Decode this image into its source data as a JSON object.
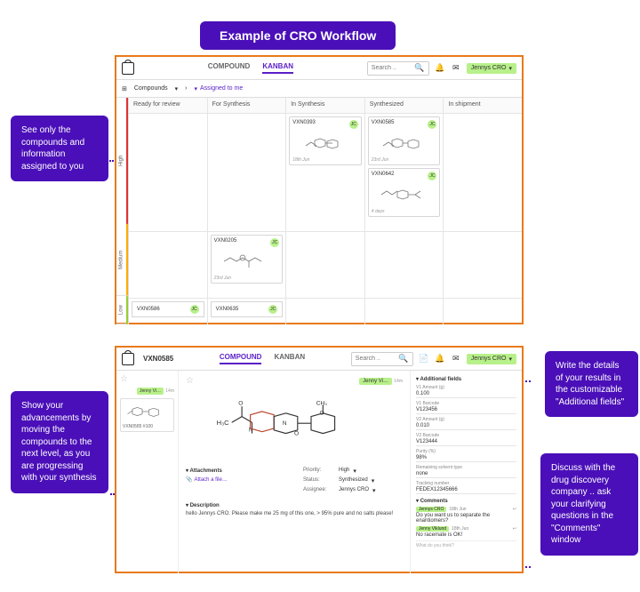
{
  "title": "Example of CRO Workflow",
  "callouts": {
    "c1": "See only the compounds and information assigned to you",
    "c2": "Write the details of your results in the customizable \"Additional fields\"",
    "c3": "Show your advancements by moving the compounds to the next level, as you are progressing with your synthesis",
    "c4": "Discuss with the drug discovery company .. ask your clarifying questions in the \"Comments\" window"
  },
  "header": {
    "tab_compound": "COMPOUND",
    "tab_kanban": "KANBAN",
    "search_placeholder": "Search ..",
    "user": "Jennys CRO"
  },
  "subheader": {
    "compounds": "Compounds",
    "filter": "Assigned to me"
  },
  "priority": {
    "high": "High",
    "medium": "Medium",
    "low": "Low"
  },
  "columns": [
    "Ready for review",
    "For Synthesis",
    "In Synthesis",
    "Synthesized",
    "In shipment"
  ],
  "cards": {
    "insynth": [
      {
        "id": "VXN0393",
        "date": "18th Jun",
        "av": "JC"
      }
    ],
    "synth": [
      {
        "id": "VXN0585",
        "date": "23rd Jun",
        "av": "JC"
      },
      {
        "id": "VXN0642",
        "date": "4 days",
        "av": "JC"
      }
    ],
    "forsynth": [
      {
        "id": "VXN0205",
        "date": "23rd Jun",
        "av": "JC"
      }
    ],
    "low_ready": {
      "id": "VXN0586",
      "av": "JC"
    },
    "low_forsynth": {
      "id": "VXN0635",
      "av": "JC"
    }
  },
  "detail": {
    "id": "VXN0585",
    "thumb_name": "VXN0585 #100",
    "assignee_chip": "Jenny Vi…",
    "time_meta": "14m",
    "attachments_h": "Attachments",
    "attach_link": "Attach a file…",
    "priority_l": "Priority:",
    "priority_v": "High",
    "status_l": "Status:",
    "status_v": "Synthesized",
    "assignee_l": "Assignee:",
    "assignee_v": "Jennys CRO",
    "desc_h": "Description",
    "desc_t": "hello Jennys CRO. Please make me 25 mg of this one, > 95% pure and no salts please!",
    "addf_h": "Additional fields",
    "v1_amount_l": "V1 Amount (g)",
    "v1_amount_v": "0.100",
    "v1_barcode_l": "V1 Barcode",
    "v1_barcode_v": "V123456",
    "v2_amount_l": "V2 Amount (g)",
    "v2_amount_v": "0.010",
    "v2_barcode_l": "V2 Barcode",
    "v2_barcode_v": "V123444",
    "purity_l": "Purity (%)",
    "purity_v": "98%",
    "solvent_l": "Remaining solvent type",
    "solvent_v": "none",
    "track_l": "Tracking number",
    "track_v": "FEDEX12345666",
    "cmt_h": "Comments",
    "cmt1_who": "Jennys CRO",
    "cmt1_date": "18th Jun",
    "cmt1_t": "Do you want us to separate the enantiomers?",
    "cmt2_who": "Jenny Viklund",
    "cmt2_date": "18th Jun",
    "cmt2_t": "No racemate is OK!",
    "cmt_ph": "What do you think?"
  }
}
